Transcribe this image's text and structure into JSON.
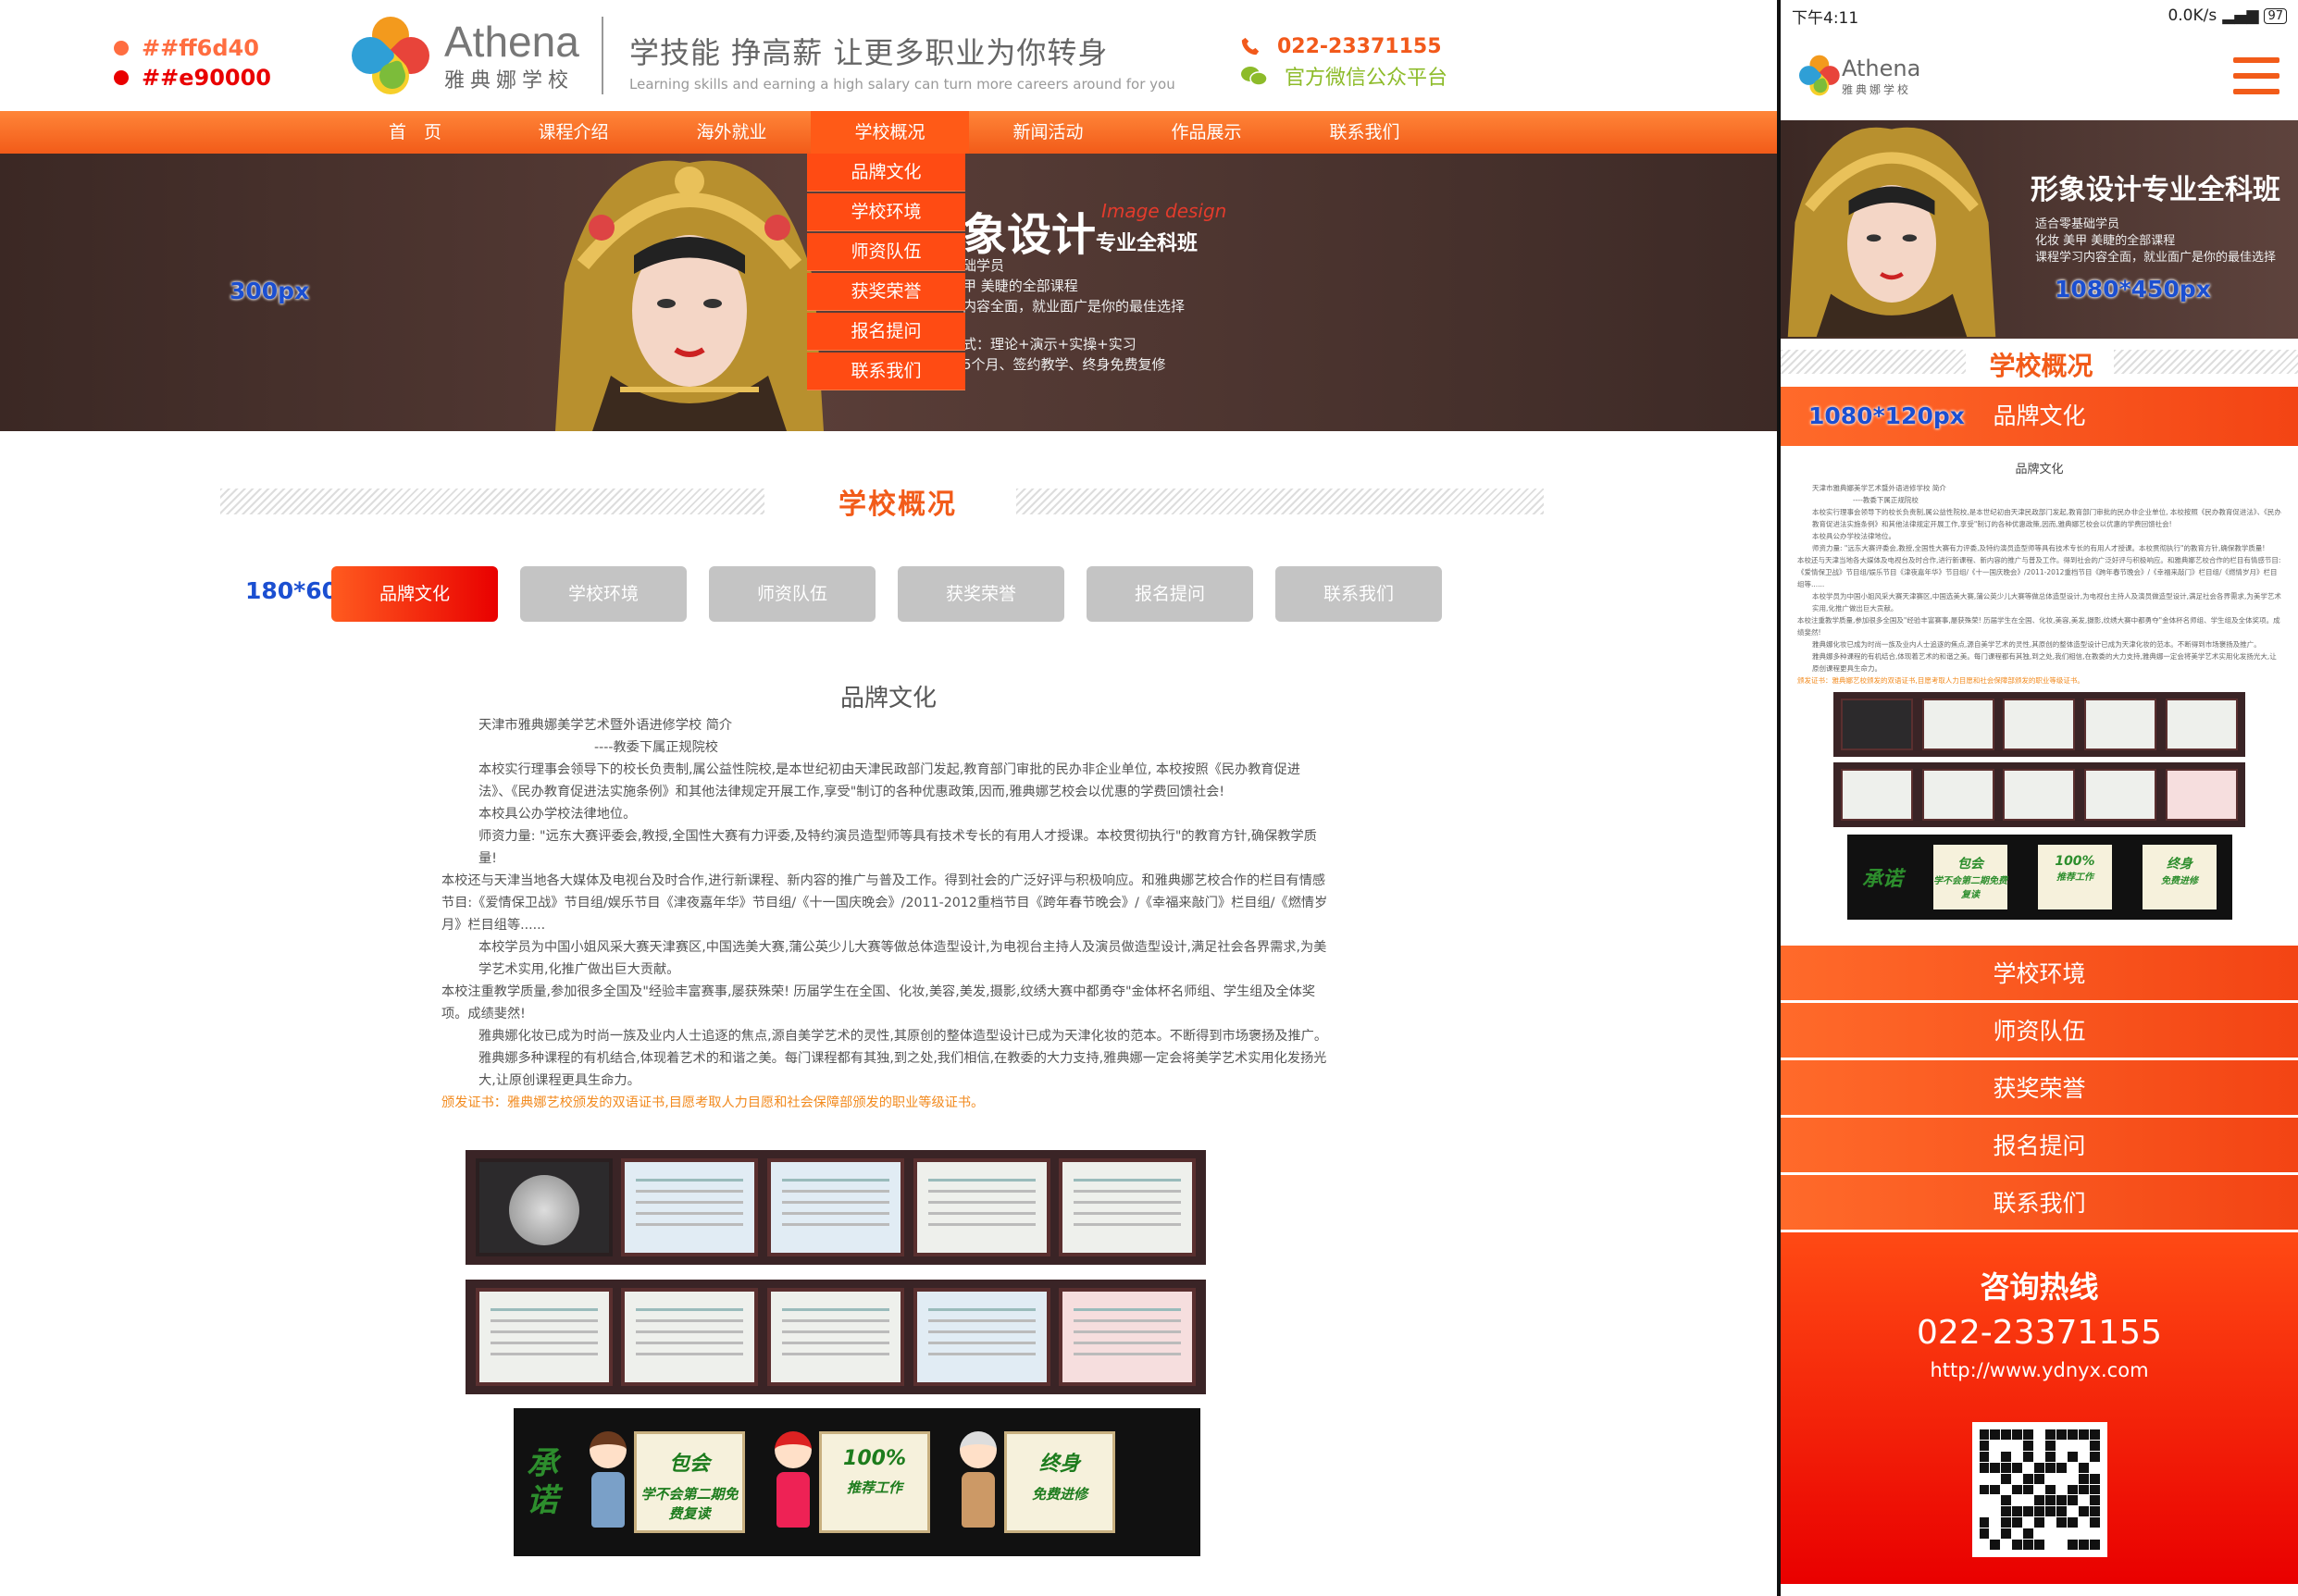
{
  "swatches": [
    "##ff6d40",
    "##e90000"
  ],
  "brand": {
    "name_en": "Athena",
    "name_cn": "雅典娜学校"
  },
  "slogan": {
    "cn": "学技能 挣高薪 让更多职业为你转身",
    "en": "Learning skills and earning a high salary can turn more careers around for you"
  },
  "contact": {
    "phone": "022-23371155",
    "wechat": "官方微信公众平台"
  },
  "nav": [
    "首　页",
    "课程介绍",
    "海外就业",
    "学校概况",
    "新闻活动",
    "作品展示",
    "联系我们"
  ],
  "dropdown": [
    "品牌文化",
    "学校环境",
    "师资队伍",
    "获奖荣誉",
    "报名提问",
    "联系我们"
  ],
  "banner": {
    "guide": "300px",
    "title": "象设计",
    "title_small": "专业全科班",
    "script": "Image design",
    "lines": [
      "础学员",
      "甲 美睫的全部课程",
      "内容全面，就业面广是你的最佳选择"
    ],
    "lines2": [
      "式：理论+演示+实操+实习",
      "5个月、签约教学、终身免费复修"
    ]
  },
  "section": {
    "title": "学校概况",
    "tab_guide": "180*60px",
    "tabs": [
      "品牌文化",
      "学校环境",
      "师资队伍",
      "获奖荣誉",
      "报名提问",
      "联系我们"
    ]
  },
  "article": {
    "title": "品牌文化",
    "p1": "天津市雅典娜美学艺术暨外语进修学校 简介",
    "p2": "----教委下属正规院校",
    "p3": "本校实行理事会领导下的校长负责制,属公益性院校,是本世纪初由天津民政部门发起,教育部门审批的民办非企业单位, 本校按照《民办教育促进法》、《民办教育促进法实施条例》和其他法律规定开展工作,享受\"制订的各种优惠政策,因而,雅典娜艺校会以优惠的学费回馈社会!",
    "p4": "本校具公办学校法律地位。",
    "p5": "师资力量: \"远东大赛评委会,教授,全国性大赛有力评委,及特约演员造型师等具有技术专长的有用人才授课。本校贯彻执行\"的教育方针,确保教学质量!",
    "p6": "本校还与天津当地各大媒体及电视台及时合作,进行新课程、新内容的推广与普及工作。得到社会的广泛好评与积极响应。和雅典娜艺校合作的栏目有情感节目:《爱情保卫战》节目组/娱乐节目《津夜嘉年华》节目组/《十一国庆晚会》/2011-2012重档节目《跨年春节晚会》/《幸福来敲门》栏目组/《燃情岁月》栏目组等......",
    "p7": "本校学员为中国小姐风采大赛天津赛区,中国选美大赛,蒲公英少儿大赛等做总体造型设计,为电视台主持人及演员做造型设计,满足社会各界需求,为美学艺术实用,化推广做出巨大贡献。",
    "p8": "本校注重教学质量,参加很多全国及\"经验丰富赛事,屡获殊荣! 历届学生在全国、化妆,美容,美发,摄影,纹绣大赛中都勇夺\"金体杯名师组、学生组及全体奖项。成绩斐然!",
    "p9": "雅典娜化妆已成为时尚一族及业内人士追逐的焦点,源自美学艺术的灵性,其原创的整体造型设计已成为天津化妆的范本。不断得到市场褒扬及推广。",
    "p10": "雅典娜多种课程的有机结合,体现着艺术的和谐之美。每门课程都有其独,到之处,我们相信,在教委的大力支持,雅典娜一定会将美学艺术实用化发扬光大,让原创课程更具生命力。",
    "cert_note": "颁发证书：雅典娜艺校颁发的双语证书,目愿考取人力目愿和社会保障部颁发的职业等级证书。"
  },
  "promise": {
    "title": "承诺",
    "cards": [
      {
        "t1": "包会",
        "t2": "学不会第二期免费复读"
      },
      {
        "t1": "100%",
        "t2": "推荐工作"
      },
      {
        "t1": "终身",
        "t2": "免费进修"
      }
    ]
  },
  "phone_ui": {
    "time": "下午4:11",
    "net": "0.0K/s",
    "battery": "97",
    "banner_title": "形象设计专业全科班",
    "banner_lines": [
      "适合零基础学员",
      "化妆 美甲 美睫的全部课程",
      "课程学习内容全面，就业面广是你的最佳选择"
    ],
    "banner_guide": "1080*450px",
    "sec_title": "学校概况",
    "active_guide": "1080*120px",
    "active": "品牌文化",
    "nav": [
      "学校环境",
      "师资队伍",
      "获奖荣誉",
      "报名提问",
      "联系我们"
    ],
    "footer": {
      "head": "咨询热线",
      "phone": "022-23371155",
      "url": "http://www.ydnyx.com"
    }
  },
  "colors": {
    "accent": "#f25b19",
    "red": "#e90000",
    "orange": "#ff6d40"
  }
}
